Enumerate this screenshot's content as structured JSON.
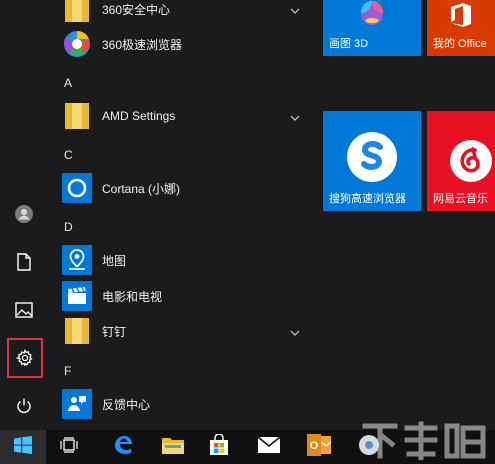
{
  "rail": {
    "items": [
      {
        "name": "user-avatar",
        "icon": "person-icon"
      },
      {
        "name": "documents",
        "icon": "document-icon"
      },
      {
        "name": "pictures",
        "icon": "image-icon"
      },
      {
        "name": "settings",
        "icon": "gear-icon",
        "highlighted": true
      },
      {
        "name": "power",
        "icon": "power-icon"
      }
    ]
  },
  "app_list": {
    "groups": [
      {
        "letter": "",
        "apps": [
          {
            "label": "360安全中心",
            "icon": "folder-icon",
            "expandable": true
          },
          {
            "label": "360极速浏览器",
            "icon": "360-browser-icon",
            "expandable": false
          }
        ]
      },
      {
        "letter": "A",
        "apps": [
          {
            "label": "AMD Settings",
            "icon": "folder-icon",
            "expandable": true
          }
        ]
      },
      {
        "letter": "C",
        "apps": [
          {
            "label": "Cortana (小娜)",
            "icon": "cortana-icon",
            "expandable": false
          }
        ]
      },
      {
        "letter": "D",
        "apps": [
          {
            "label": "地图",
            "icon": "maps-icon",
            "expandable": false
          },
          {
            "label": "电影和电视",
            "icon": "movies-icon",
            "expandable": false
          },
          {
            "label": "钉钉",
            "icon": "folder-icon",
            "expandable": true
          }
        ]
      },
      {
        "letter": "F",
        "apps": [
          {
            "label": "反馈中心",
            "icon": "feedback-icon",
            "expandable": false
          }
        ]
      }
    ]
  },
  "tiles": [
    {
      "label": "画图 3D",
      "color": "#0078d7",
      "icon": "paint3d-icon"
    },
    {
      "label": "我的 Office",
      "color": "#d83b01",
      "icon": "office-icon"
    },
    {
      "label": "搜狗高速浏览器",
      "color": "#0078d7",
      "icon": "sogou-icon"
    },
    {
      "label": "网易云音乐",
      "color": "#e81123",
      "icon": "netease-music-icon"
    }
  ],
  "taskbar": {
    "items": [
      {
        "name": "start",
        "icon": "windows-logo-icon"
      },
      {
        "name": "task-view",
        "icon": "task-view-icon"
      },
      {
        "name": "edge",
        "icon": "edge-icon"
      },
      {
        "name": "file-explorer",
        "icon": "folder-icon"
      },
      {
        "name": "store",
        "icon": "store-icon"
      },
      {
        "name": "mail",
        "icon": "mail-icon"
      },
      {
        "name": "outlook",
        "icon": "outlook-icon"
      },
      {
        "name": "chrome",
        "icon": "chrome-icon"
      }
    ]
  },
  "colors": {
    "accent": "#0078d7",
    "highlight_outline": "#d9363e",
    "background": "#1b1b1d",
    "taskbar": "#101010"
  },
  "watermark": {
    "text": "下载吧"
  }
}
